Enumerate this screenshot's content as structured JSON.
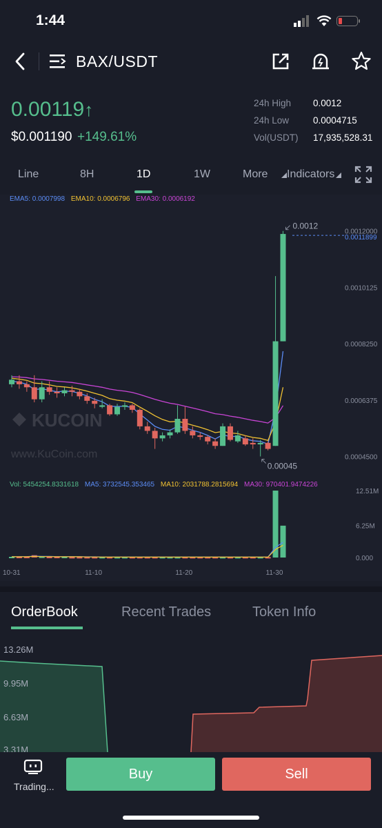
{
  "status": {
    "time": "1:44"
  },
  "header": {
    "pair": "BAX/USDT"
  },
  "ticker": {
    "price": "0.00119",
    "arrow": "↑",
    "usd_price": "$0.001190",
    "change_pct": "+149.61%",
    "stats": [
      {
        "label": "24h High",
        "value": "0.0012"
      },
      {
        "label": "24h Low",
        "value": "0.0004715"
      },
      {
        "label": "Vol(USDT)",
        "value": "17,935,528.31"
      }
    ]
  },
  "timeframe_tabs": [
    "Line",
    "8H",
    "1D",
    "1W",
    "More",
    "Indicators"
  ],
  "active_timeframe": "1D",
  "indicators": {
    "ema5": "EMA5: 0.0007998",
    "ema10": "EMA10: 0.0006796",
    "ema30": "EMA30: 0.0006192"
  },
  "volume_indicators": {
    "vol": "Vol: 5454254.8331618",
    "ma5": "MA5: 3732545.353465",
    "ma10": "MA10: 2031788.2815694",
    "ma30": "MA30: 970401.9474226"
  },
  "watermark": {
    "brand": "KUCOIN",
    "url": "www.KuCoin.com"
  },
  "chart_data": {
    "type": "candlestick",
    "price_axis_labels": [
      "0.0012000",
      "0.0011899",
      "0.0010125",
      "0.0008250",
      "0.0006375",
      "0.0004500"
    ],
    "volume_axis_labels": [
      "12.51M",
      "6.25M",
      "0.000"
    ],
    "x_labels": [
      "10-31",
      "11-10",
      "11-20",
      "11-30"
    ],
    "high_marker": "0.0012",
    "low_marker": "0.00045",
    "y_range": [
      0.000435,
      0.00122
    ],
    "candles": [
      {
        "o": 0.00069,
        "c": 0.000705,
        "h": 0.00072,
        "l": 0.00068
      },
      {
        "o": 0.0007,
        "c": 0.00069,
        "h": 0.00072,
        "l": 0.000675
      },
      {
        "o": 0.00069,
        "c": 0.00068,
        "h": 0.0007,
        "l": 0.000665
      },
      {
        "o": 0.00068,
        "c": 0.00064,
        "h": 0.00072,
        "l": 0.00063
      },
      {
        "o": 0.00064,
        "c": 0.00068,
        "h": 0.0007,
        "l": 0.00063
      },
      {
        "o": 0.00068,
        "c": 0.000665,
        "h": 0.0007,
        "l": 0.000655
      },
      {
        "o": 0.000665,
        "c": 0.00066,
        "h": 0.00068,
        "l": 0.000645
      },
      {
        "o": 0.00066,
        "c": 0.00067,
        "h": 0.00068,
        "l": 0.00065
      },
      {
        "o": 0.00067,
        "c": 0.000665,
        "h": 0.000685,
        "l": 0.00065
      },
      {
        "o": 0.000665,
        "c": 0.00065,
        "h": 0.000675,
        "l": 0.00064
      },
      {
        "o": 0.00065,
        "c": 0.000635,
        "h": 0.00066,
        "l": 0.000625
      },
      {
        "o": 0.000635,
        "c": 0.000625,
        "h": 0.000645,
        "l": 0.00061
      },
      {
        "o": 0.000615,
        "c": 0.00062,
        "h": 0.00064,
        "l": 0.00061
      },
      {
        "o": 0.00062,
        "c": 0.00059,
        "h": 0.000625,
        "l": 0.000585
      },
      {
        "o": 0.00059,
        "c": 0.000615,
        "h": 0.000625,
        "l": 0.000585
      },
      {
        "o": 0.000615,
        "c": 0.00062,
        "h": 0.00063,
        "l": 0.000605
      },
      {
        "o": 0.00062,
        "c": 0.000605,
        "h": 0.000625,
        "l": 0.000595
      },
      {
        "o": 0.000605,
        "c": 0.00055,
        "h": 0.00061,
        "l": 0.00054
      },
      {
        "o": 0.00055,
        "c": 0.000535,
        "h": 0.000565,
        "l": 0.000525
      },
      {
        "o": 0.000535,
        "c": 0.00051,
        "h": 0.000545,
        "l": 0.000475
      },
      {
        "o": 0.00051,
        "c": 0.00052,
        "h": 0.00053,
        "l": 0.0005
      },
      {
        "o": 0.00052,
        "c": 0.00053,
        "h": 0.00054,
        "l": 0.00051
      },
      {
        "o": 0.00053,
        "c": 0.000575,
        "h": 0.00062,
        "l": 0.000525
      },
      {
        "o": 0.000575,
        "c": 0.000535,
        "h": 0.000615,
        "l": 0.000525
      },
      {
        "o": 0.000535,
        "c": 0.00052,
        "h": 0.00055,
        "l": 0.00051
      },
      {
        "o": 0.00052,
        "c": 0.000515,
        "h": 0.00053,
        "l": 0.000505
      },
      {
        "o": 0.000515,
        "c": 0.0005,
        "h": 0.00052,
        "l": 0.00049
      },
      {
        "o": 0.0005,
        "c": 0.000485,
        "h": 0.00051,
        "l": 0.000475
      },
      {
        "o": 0.000485,
        "c": 0.00055,
        "h": 0.00056,
        "l": 0.000485
      },
      {
        "o": 0.00055,
        "c": 0.000505,
        "h": 0.00056,
        "l": 0.0005
      },
      {
        "o": 0.0005,
        "c": 0.00052,
        "h": 0.000535,
        "l": 0.000495
      },
      {
        "o": 0.00051,
        "c": 0.00049,
        "h": 0.00052,
        "l": 0.000485
      },
      {
        "o": 0.000495,
        "c": 0.00049,
        "h": 0.00051,
        "l": 0.000475
      },
      {
        "o": 0.00049,
        "c": 0.000495,
        "h": 0.000505,
        "l": 0.00045
      },
      {
        "o": 0.000495,
        "c": 0.000475,
        "h": 0.0005,
        "l": 0.00047
      },
      {
        "o": 0.000485,
        "c": 0.000833,
        "h": 0.00105,
        "l": 0.000485
      },
      {
        "o": 0.000833,
        "c": 0.00119,
        "h": 0.0012,
        "l": 0.000833
      }
    ],
    "volumes": [
      0.15,
      0.15,
      0.15,
      0.5,
      0.2,
      0.15,
      0.15,
      0.15,
      0.1,
      0.1,
      0.1,
      0.1,
      0.1,
      0.1,
      0.1,
      0.1,
      0.1,
      0.1,
      0.1,
      0.1,
      0.1,
      0.1,
      0.1,
      0.1,
      0.1,
      0.1,
      0.1,
      0.1,
      0.1,
      0.1,
      0.1,
      0.1,
      0.1,
      0.1,
      0.1,
      14.5,
      6.9
    ],
    "ema5": [
      0.0007,
      0.000697,
      0.00069,
      0.000672,
      0.000675,
      0.00067,
      0.000665,
      0.000667,
      0.000666,
      0.00066,
      0.000651,
      0.00064,
      0.000632,
      0.000617,
      0.000616,
      0.000617,
      0.000613,
      0.000591,
      0.000571,
      0.00055,
      0.00054,
      0.000537,
      0.00055,
      0.000545,
      0.000537,
      0.00053,
      0.00052,
      0.000508,
      0.000522,
      0.000516,
      0.000517,
      0.000508,
      0.000502,
      0.0005,
      0.000491,
      0.000605,
      0.0008
    ],
    "ema10": [
      0.00071,
      0.000707,
      0.000703,
      0.000694,
      0.000692,
      0.000688,
      0.000683,
      0.000681,
      0.000678,
      0.000673,
      0.000667,
      0.00066,
      0.000653,
      0.000642,
      0.000637,
      0.000634,
      0.000629,
      0.000614,
      0.0006,
      0.000585,
      0.000573,
      0.000565,
      0.000567,
      0.000561,
      0.000554,
      0.000547,
      0.000539,
      0.000529,
      0.000533,
      0.000528,
      0.000526,
      0.000519,
      0.000513,
      0.00051,
      0.000503,
      0.000563,
      0.00068
    ],
    "ema30": [
      0.000715,
      0.000714,
      0.000712,
      0.000708,
      0.000706,
      0.000703,
      0.0007,
      0.000698,
      0.000696,
      0.000692,
      0.000688,
      0.000684,
      0.00068,
      0.000674,
      0.00067,
      0.000667,
      0.000663,
      0.000656,
      0.000648,
      0.00064,
      0.000633,
      0.000627,
      0.000623,
      0.000617,
      0.000611,
      0.000605,
      0.000599,
      0.000592,
      0.000589,
      0.000584,
      0.00058,
      0.000575,
      0.00057,
      0.000566,
      0.000561,
      0.000579,
      0.000619
    ],
    "vol_ma": [
      0.2,
      0.2,
      0.2,
      0.3,
      0.25,
      0.25,
      0.2,
      0.2,
      0.2,
      0.2,
      0.15,
      0.15,
      0.12,
      0.12,
      0.12,
      0.12,
      0.12,
      0.12,
      0.12,
      0.12,
      0.12,
      0.12,
      0.12,
      0.12,
      0.12,
      0.12,
      0.12,
      0.12,
      0.12,
      0.12,
      0.12,
      0.12,
      0.12,
      0.12,
      0.12,
      2.2,
      3.3
    ]
  },
  "orderbook_tabs": [
    "OrderBook",
    "Recent Trades",
    "Token Info"
  ],
  "depth_labels": [
    "13.26M",
    "9.95M",
    "6.63M",
    "3.31M"
  ],
  "bottom": {
    "trading_label": "Trading...",
    "buy_label": "Buy",
    "sell_label": "Sell"
  },
  "colors": {
    "up": "#56be8d",
    "down": "#e0675f",
    "ema5": "#5b8cf5",
    "ema10": "#f1c232",
    "ema30": "#c945d6"
  }
}
